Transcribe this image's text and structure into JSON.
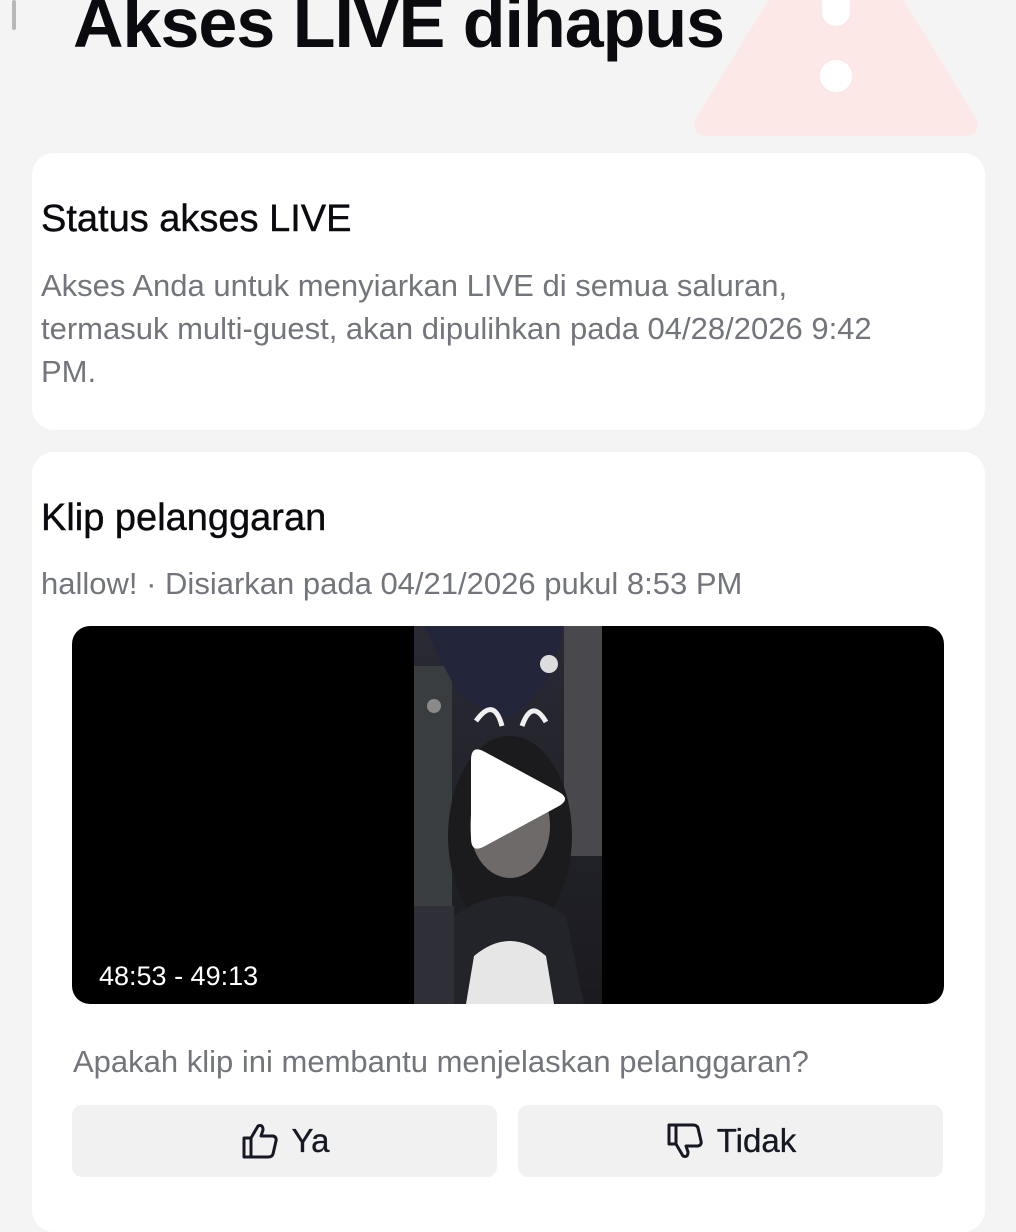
{
  "header": {
    "title": "Akses LIVE dihapus"
  },
  "status_card": {
    "heading": "Status akses LIVE",
    "message": "Akses Anda untuk menyiarkan LIVE di semua saluran, termasuk multi-guest, akan dipulihkan pada 04/28/2026 9:42 PM."
  },
  "clip_card": {
    "heading": "Klip pelanggaran",
    "meta": "hallow! · Disiarkan pada 04/21/2026 pukul 8:53 PM",
    "video": {
      "timestamp": "48:53 - 49:13"
    },
    "feedback": {
      "question": "Apakah klip ini membantu menjelaskan pelanggaran?",
      "yes_label": "Ya",
      "no_label": "Tidak"
    }
  },
  "colors": {
    "page_background": "#f4f4f4",
    "card_background": "#ffffff",
    "secondary_text": "#73757c",
    "warning_tint": "#fde8e8",
    "button_background": "#f1f1f2"
  },
  "icons": {
    "warning": "warning-triangle-icon",
    "play": "play-icon",
    "yes": "thumbs-up-icon",
    "no": "thumbs-down-icon"
  }
}
